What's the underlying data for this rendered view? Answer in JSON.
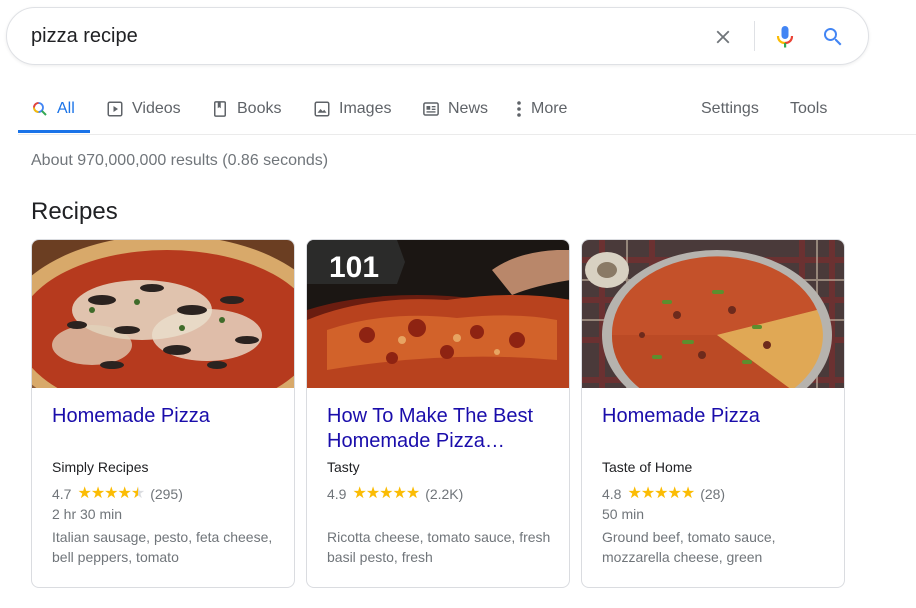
{
  "search": {
    "query": "pizza recipe"
  },
  "tabs": [
    {
      "label": "All",
      "icon": "search-icon",
      "active": true
    },
    {
      "label": "Videos",
      "icon": "video-icon"
    },
    {
      "label": "Books",
      "icon": "book-icon"
    },
    {
      "label": "Images",
      "icon": "image-icon"
    },
    {
      "label": "News",
      "icon": "news-icon"
    },
    {
      "label": "More",
      "icon": "more-vertical-icon"
    }
  ],
  "tools": {
    "settings_label": "Settings",
    "tools_label": "Tools"
  },
  "result_stats": "About 970,000,000 results (0.86 seconds)",
  "recipes": {
    "heading": "Recipes",
    "cards": [
      {
        "title": "Homemade Pizza",
        "source": "Simply Recipes",
        "rating": "4.7",
        "stars": 4.7,
        "reviews": "(295)",
        "time": "2 hr 30 min",
        "ingredients": "Italian sausage, pesto, feta cheese, bell peppers, tomato",
        "thumbnail": "pizza-photo"
      },
      {
        "title": "How To Make The Best Homemade Pizza…",
        "source": "Tasty",
        "rating": "4.9",
        "stars": 4.9,
        "reviews": "(2.2K)",
        "time": "",
        "ingredients": "Ricotta cheese, tomato sauce, fresh basil pesto, fresh",
        "thumbnail": "pizza-photo",
        "badge": "101"
      },
      {
        "title": "Homemade Pizza",
        "source": "Taste of Home",
        "rating": "4.8",
        "stars": 4.8,
        "reviews": "(28)",
        "time": "50 min",
        "ingredients": "Ground beef, tomato sauce, mozzarella cheese, green",
        "thumbnail": "pizza-photo"
      }
    ]
  },
  "colors": {
    "accent": "#1a73e8",
    "link": "#1a0dab",
    "star": "#fbbc04",
    "muted": "#70757a"
  }
}
